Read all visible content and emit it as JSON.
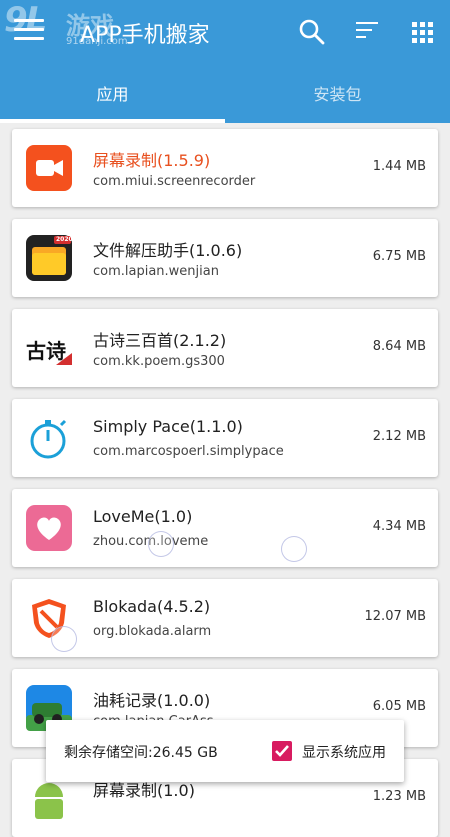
{
  "header": {
    "title": "APP手机搬家",
    "watermark_logo": "9L",
    "watermark_text": "游戏",
    "watermark_url": "91danji.com"
  },
  "tabs": [
    {
      "label": "应用",
      "active": true
    },
    {
      "label": "安装包",
      "active": false
    }
  ],
  "apps": [
    {
      "name": "屏幕录制(1.5.9)",
      "package": "com.miui.screenrecorder",
      "size": "1.44 MB",
      "icon": "video-camera-icon",
      "name_color": "#e8501f"
    },
    {
      "name": "文件解压助手(1.0.6)",
      "package": "com.lapian.wenjian",
      "size": "6.75 MB",
      "icon": "folder-icon"
    },
    {
      "name": "古诗三百首(2.1.2)",
      "package": "com.kk.poem.gs300",
      "size": "8.64 MB",
      "icon": "poem-icon"
    },
    {
      "name": "Simply Pace(1.1.0)",
      "package": "com.marcospoerl.simplypace",
      "size": "2.12 MB",
      "icon": "stopwatch-icon"
    },
    {
      "name": "LoveMe(1.0)",
      "package": "zhou.com.loveme",
      "size": "4.34 MB",
      "icon": "heart-icon"
    },
    {
      "name": "Blokada(4.5.2)",
      "package": "org.blokada.alarm",
      "size": "12.07 MB",
      "icon": "shield-icon"
    },
    {
      "name": "油耗记录(1.0.0)",
      "package": "com.lapian.CarAss",
      "size": "6.05 MB",
      "icon": "car-icon"
    },
    {
      "name": "屏幕录制(1.0)",
      "package": "",
      "size": "1.23 MB",
      "icon": "android-icon"
    }
  ],
  "icon_labels": {
    "poem": "古诗",
    "folder_badge": "2020"
  },
  "bottom": {
    "storage_text": "剩余存储空间:26.45 GB",
    "show_system_label": "显示系统应用",
    "show_system_checked": true
  },
  "colors": {
    "primary": "#3a99d8",
    "highlight_name": "#e8501f",
    "checkbox": "#d81b60"
  }
}
